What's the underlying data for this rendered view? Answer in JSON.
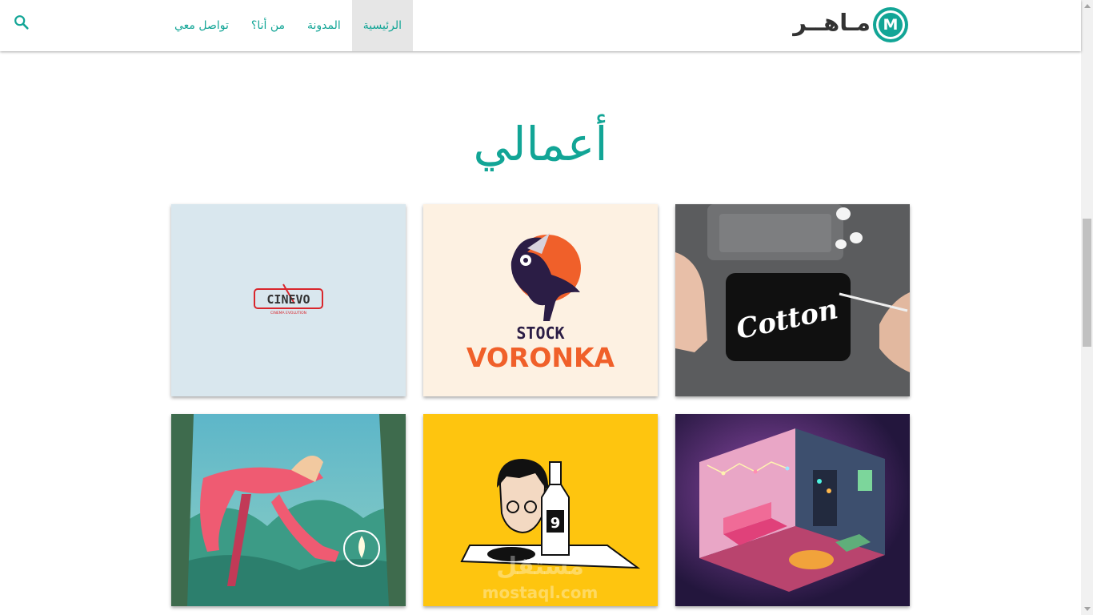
{
  "nav": {
    "logo_text": "مـاهــر",
    "logo_letter": "M",
    "links": [
      {
        "label": "تواصل معي",
        "active": false
      },
      {
        "label": "من أنا؟",
        "active": false
      },
      {
        "label": "المدونة",
        "active": false
      },
      {
        "label": "الرئيسية",
        "active": true
      }
    ],
    "search_icon": "search-icon"
  },
  "section": {
    "title": "أعمالي"
  },
  "portfolio": {
    "items": [
      {
        "name": "cinevo",
        "logo_text": "CINEVO",
        "tagline": "CINEMA EVOLUTION",
        "background": "#d9e7ee"
      },
      {
        "name": "stock-voronka",
        "line1": "STOCK",
        "line2": "VORONKA",
        "background": "#fdf1e2"
      },
      {
        "name": "cotton",
        "lettering": "Cotton",
        "background": "#58595b"
      },
      {
        "name": "giant-illustration",
        "background": "#3f9a8a"
      },
      {
        "name": "bottle-illustration",
        "watermark": "مستقل",
        "watermark_url": "mostaql.com",
        "background": "#fec50f"
      },
      {
        "name": "isometric-room",
        "background": "#2c1f4a"
      }
    ]
  },
  "colors": {
    "accent": "#12a596",
    "nav_active_bg": "#e6e6e6"
  }
}
